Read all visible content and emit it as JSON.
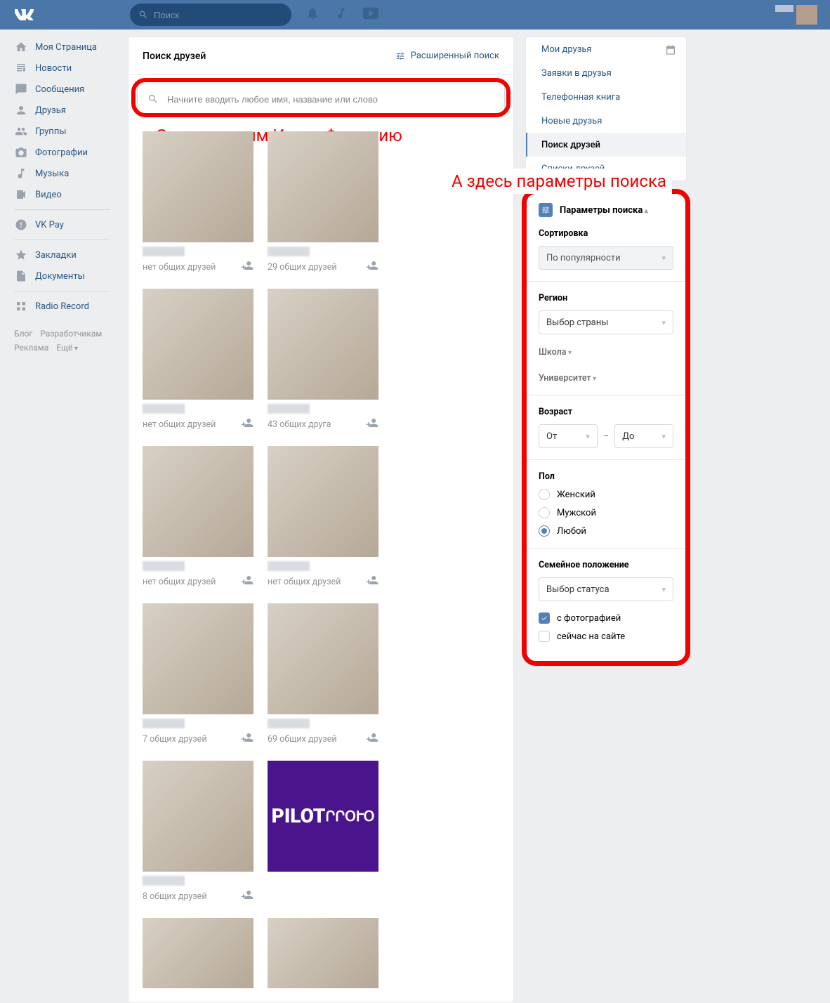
{
  "header": {
    "search_placeholder": "Поиск"
  },
  "leftnav": {
    "items": [
      {
        "label": "Моя Страница",
        "icon": "home"
      },
      {
        "label": "Новости",
        "icon": "news"
      },
      {
        "label": "Сообщения",
        "icon": "msg"
      },
      {
        "label": "Друзья",
        "icon": "friend"
      },
      {
        "label": "Группы",
        "icon": "groups"
      },
      {
        "label": "Фотографии",
        "icon": "photo"
      },
      {
        "label": "Музыка",
        "icon": "music"
      },
      {
        "label": "Видео",
        "icon": "video"
      }
    ],
    "items2": [
      {
        "label": "VK Pay",
        "icon": "pay"
      }
    ],
    "items3": [
      {
        "label": "Закладки",
        "icon": "star"
      },
      {
        "label": "Документы",
        "icon": "doc"
      }
    ],
    "items4": [
      {
        "label": "Radio Record",
        "icon": "app"
      }
    ],
    "footer": {
      "a": "Блог",
      "b": "Разработчикам",
      "c": "Реклама",
      "d": "Ещё"
    }
  },
  "search_card": {
    "title": "Поиск друзей",
    "advanced": "Расширенный поиск",
    "input_placeholder": "Начните вводить любое имя, название или слово"
  },
  "annotations": {
    "a1": "Здесь вводим Имя и Фамилию",
    "a2": "А здесь параметры поиска"
  },
  "results": [
    {
      "mutual": "нет общих друзей",
      "ph": "ph-ballet"
    },
    {
      "mutual": "29 общих друзей",
      "ph": "ph-suit"
    },
    {
      "mutual": "нет общих друзей",
      "ph": "ph-winter"
    },
    {
      "mutual": "43 общих друга",
      "ph": "ph-globe"
    },
    {
      "mutual": "нет общих друзей",
      "ph": "ph-mirror"
    },
    {
      "mutual": "нет общих друзей",
      "ph": "ph-bw"
    },
    {
      "mutual": "7 общих друзей",
      "ph": "ph-face"
    },
    {
      "mutual": "69 общих друзей",
      "ph": "ph-brick"
    },
    {
      "mutual": "8 общих друзей",
      "ph": "ph-fork"
    }
  ],
  "right_tabs": {
    "items": [
      "Мои друзья",
      "Заявки в друзья",
      "Телефонная книга",
      "Новые друзья",
      "Поиск друзей",
      "Списки друзей"
    ],
    "active_index": 4
  },
  "params": {
    "title": "Параметры поиска",
    "sort": {
      "label": "Сортировка",
      "value": "По популярности"
    },
    "region": {
      "label": "Регион",
      "value": "Выбор страны"
    },
    "school": "Школа",
    "university": "Университет",
    "age": {
      "label": "Возраст",
      "from": "От",
      "to": "До"
    },
    "sex": {
      "label": "Пол",
      "options": [
        "Женский",
        "Мужской",
        "Любой"
      ],
      "selected": 2
    },
    "marital": {
      "label": "Семейное положение",
      "value": "Выбор статуса"
    },
    "with_photo": "с фотографией",
    "online_now": "сейчас на сайте"
  }
}
